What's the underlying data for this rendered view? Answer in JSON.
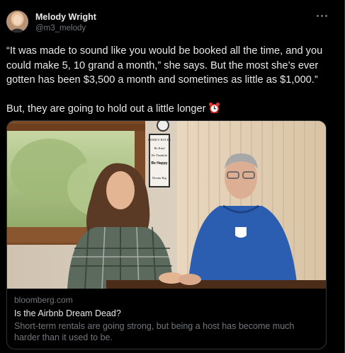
{
  "author": {
    "name": "Melody Wright",
    "handle": "@m3_melody"
  },
  "tweet": {
    "paragraph1": "“It was made to sound like you would be booked all the time, and you could make 5, 10 grand a month,” she says. But the most she’s ever gotten has been $3,500 a month and sometimes as little as $1,000.”",
    "paragraph2": "But, they are going to hold out a little longer",
    "emoji": "alarm-clock-icon"
  },
  "link_card": {
    "domain": "bloomberg.com",
    "title": "Is the Airbnb Dream Dead?",
    "description": "Short-term rentals are going strong, but being a host has become much harder than it used to be.",
    "sign_text": [
      "FAMILY RULES",
      "Be Kind",
      "Be Thankful",
      "Be Happy",
      "Dream Big"
    ]
  },
  "colors": {
    "background": "#000000",
    "primary_text": "#e7e9ea",
    "secondary_text": "#71767b",
    "border": "#2f3336",
    "alarm_red": "#e0332f"
  }
}
